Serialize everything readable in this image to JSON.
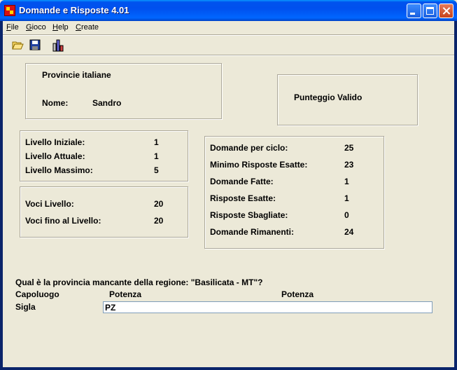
{
  "window": {
    "title": "Domande e Risposte 4.01"
  },
  "menu": {
    "file": {
      "hot": "F",
      "rest": "ile"
    },
    "gioco": {
      "hot": "G",
      "rest": "ioco"
    },
    "help": {
      "hot": "H",
      "rest": "elp"
    },
    "create": {
      "hot": "C",
      "rest": "reate"
    }
  },
  "toolbar": {
    "icons": [
      "open-folder-icon",
      "save-disk-icon",
      "stats-icon"
    ]
  },
  "info": {
    "category": "Provincie italiane",
    "name_label": "Nome:",
    "name_value": "Sandro"
  },
  "score": {
    "label": "Punteggio Valido"
  },
  "levels": [
    {
      "label": "Livello Iniziale:",
      "value": "1"
    },
    {
      "label": "Livello Attuale:",
      "value": "1"
    },
    {
      "label": "Livello Massimo:",
      "value": "5"
    }
  ],
  "voci": [
    {
      "label": "Voci Livello:",
      "value": "20"
    },
    {
      "label": "Voci fino al Livello:",
      "value": "20"
    }
  ],
  "stats": [
    {
      "label": "Domande per ciclo:",
      "value": "25"
    },
    {
      "label": "Minimo Risposte Esatte:",
      "value": "23"
    },
    {
      "label": "Domande Fatte:",
      "value": "1"
    },
    {
      "label": "Risposte Esatte:",
      "value": "1"
    },
    {
      "label": "Risposte Sbagliate:",
      "value": "0"
    },
    {
      "label": "Domande Rimanenti:",
      "value": "24"
    }
  ],
  "question": {
    "text": "Qual è la provincia mancante della regione: \"Basilicata - MT\"?",
    "capoluogo_label": "Capoluogo",
    "capoluogo_value": "Potenza",
    "capoluogo_value2": "Potenza",
    "sigla_label": "Sigla",
    "sigla_value": "PZ"
  }
}
